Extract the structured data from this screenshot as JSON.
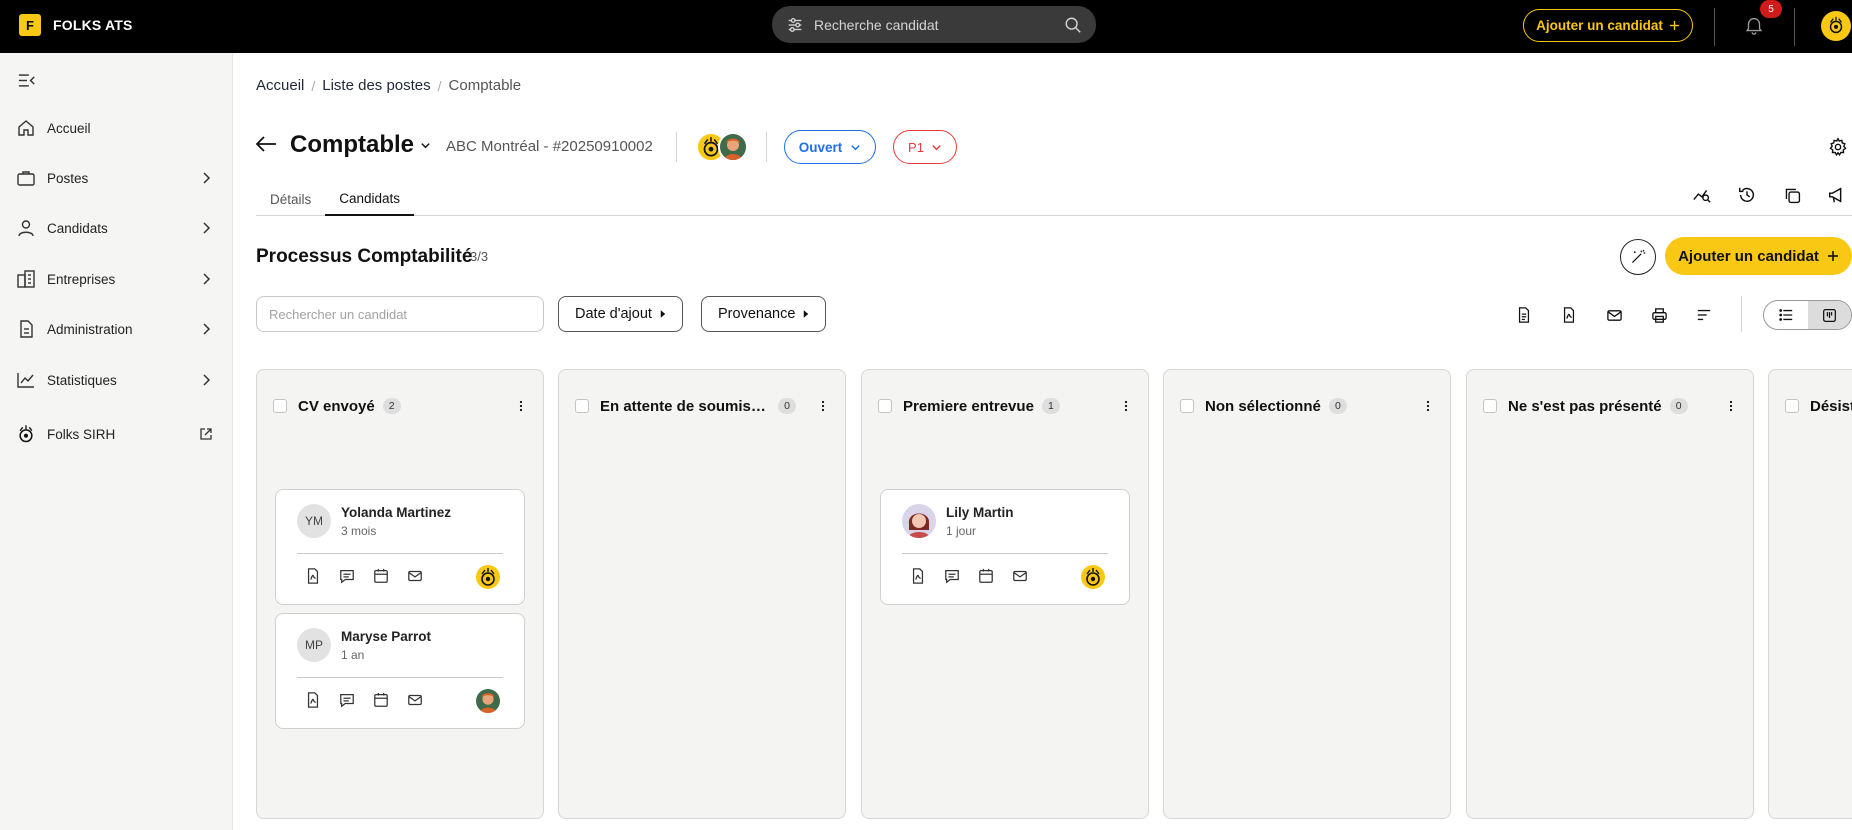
{
  "app": {
    "logo_letter": "F",
    "name": "FOLKS ATS"
  },
  "topbar": {
    "search_placeholder": "Recherche candidat",
    "add_candidate_label": "Ajouter un candidat",
    "notifications_count": "5"
  },
  "sidebar": {
    "items": [
      {
        "label": "Accueil",
        "icon": "home-icon"
      },
      {
        "label": "Postes",
        "icon": "briefcase-icon"
      },
      {
        "label": "Candidats",
        "icon": "user-icon"
      },
      {
        "label": "Entreprises",
        "icon": "building-icon"
      },
      {
        "label": "Administration",
        "icon": "document-icon"
      },
      {
        "label": "Statistiques",
        "icon": "chart-icon"
      },
      {
        "label": "Folks SIRH",
        "icon": "folks-logo-icon"
      }
    ]
  },
  "breadcrumb": {
    "home": "Accueil",
    "list": "Liste des postes",
    "current": "Comptable"
  },
  "job": {
    "title": "Comptable",
    "subtitle": "ABC Montréal - #20250910002",
    "status": "Ouvert",
    "priority": "P1"
  },
  "tabs": [
    {
      "label": "Détails"
    },
    {
      "label": "Candidats"
    }
  ],
  "process": {
    "title": "Processus Comptabilité",
    "count": "3/3",
    "add_label": "Ajouter un candidat"
  },
  "filters": {
    "search_placeholder": "Rechercher un candidat",
    "date_label": "Date d'ajout",
    "source_label": "Provenance"
  },
  "columns": [
    {
      "title": "CV envoyé",
      "count": "2"
    },
    {
      "title": "En attente de soumission",
      "count": "0"
    },
    {
      "title": "Premiere entrevue",
      "count": "1"
    },
    {
      "title": "Non sélectionné",
      "count": "0"
    },
    {
      "title": "Ne s'est pas présenté",
      "count": "0"
    },
    {
      "title": "Désisté"
    }
  ],
  "cards": [
    {
      "initials": "YM",
      "name": "Yolanda Martinez",
      "time": "3 mois"
    },
    {
      "initials": "MP",
      "name": "Maryse Parrot",
      "time": "1 an"
    },
    {
      "initials": "",
      "name": "Lily Martin",
      "time": "1 jour"
    }
  ],
  "colors": {
    "brand_yellow": "#f8c814",
    "status_blue": "#1f6feb",
    "priority_red": "#ea3b3b",
    "badge_red": "#d11a1a"
  }
}
